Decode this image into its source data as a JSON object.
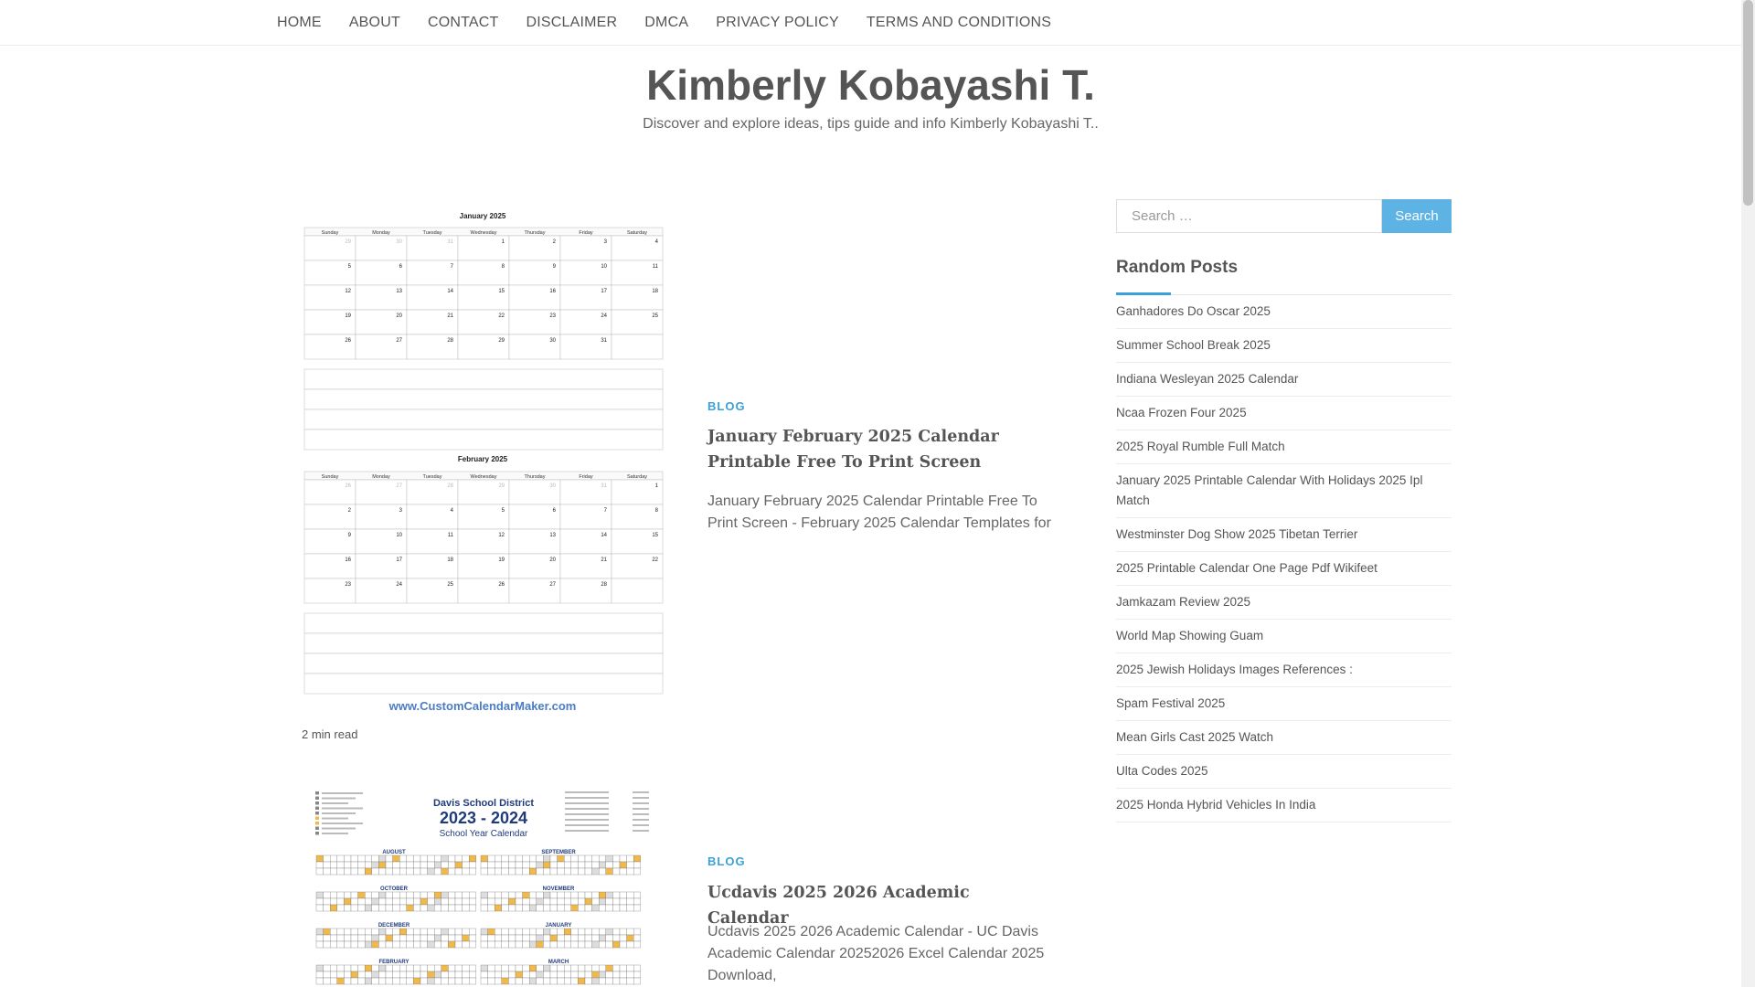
{
  "nav": {
    "items": [
      "HOME",
      "ABOUT",
      "CONTACT",
      "DISCLAIMER",
      "DMCA",
      "PRIVACY POLICY",
      "TERMS AND CONDITIONS"
    ]
  },
  "header": {
    "title": "Kimberly Kobayashi T.",
    "description": "Discover and explore ideas, tips guide and info Kimberly Kobayashi T.."
  },
  "posts": [
    {
      "thumbnail": {
        "month1": "January 2025",
        "month2": "February 2025",
        "days": [
          "Sunday",
          "Monday",
          "Tuesday",
          "Wednesday",
          "Thursday",
          "Friday",
          "Saturday"
        ],
        "footer": "www.CustomCalendarMaker.com"
      },
      "read_time": "2 min read",
      "category": "BLOG",
      "title": "January February 2025 Calendar Printable Free To Print Screen",
      "excerpt": "January February 2025 Calendar Printable Free To Print Screen - February 2025 Calendar Templates for"
    },
    {
      "thumbnail": {
        "heading1": "Davis School District",
        "heading2": "2023 - 2024",
        "heading3": "School Year Calendar",
        "months": [
          "AUGUST",
          "SEPTEMBER",
          "OCTOBER",
          "NOVEMBER",
          "DECEMBER",
          "JANUARY",
          "FEBRUARY",
          "MARCH"
        ]
      },
      "category": "BLOG",
      "title": "Ucdavis 2025 2026 Academic Calendar",
      "excerpt": "Ucdavis 2025 2026 Academic Calendar - UC Davis Academic Calendar 20252026 Excel Calendar 2025 Download,"
    }
  ],
  "sidebar": {
    "search_placeholder": "Search …",
    "search_button": "Search",
    "random_posts_title": "Random Posts",
    "random_posts": [
      "Ganhadores Do Oscar 2025",
      "Summer School Break 2025",
      "Indiana Wesleyan 2025 Calendar",
      "Ncaa Frozen Four 2025",
      "2025 Royal Rumble Full Match",
      "January 2025 Printable Calendar With Holidays 2025 Ipl Match",
      "Westminster Dog Show 2025 Tibetan Terrier",
      "2025 Printable Calendar One Page Pdf Wikifeet",
      "Jamkazam Review 2025",
      "World Map Showing Guam",
      "2025 Jewish Holidays Images References :",
      "Spam Festival 2025",
      "Mean Girls Cast 2025 Watch",
      "Ulta Codes 2025",
      "2025 Honda Hybrid Vehicles In India"
    ]
  },
  "colors": {
    "accent": "#3ba1d9",
    "button": "#5cb3e4",
    "text": "#555555"
  }
}
